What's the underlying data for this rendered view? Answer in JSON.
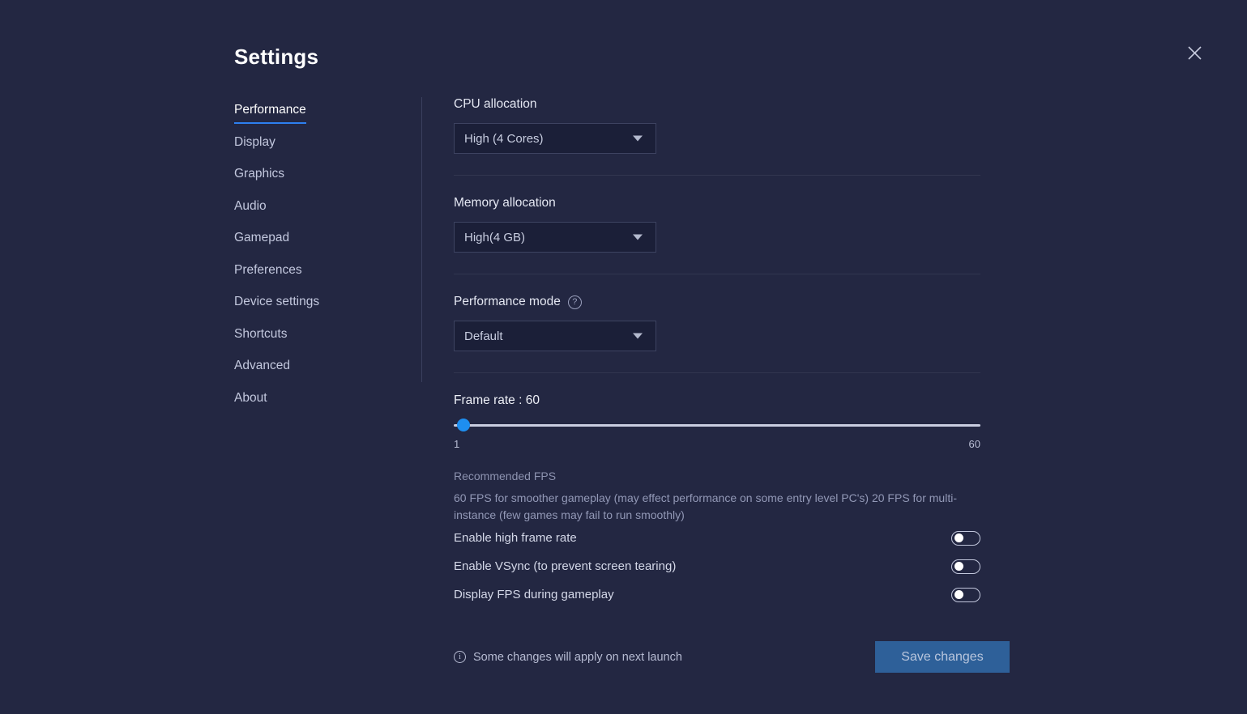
{
  "window": {
    "title": "Settings",
    "close_icon": "close-icon"
  },
  "sidebar": {
    "items": [
      {
        "label": "Performance",
        "active": true
      },
      {
        "label": "Display",
        "active": false
      },
      {
        "label": "Graphics",
        "active": false
      },
      {
        "label": "Audio",
        "active": false
      },
      {
        "label": "Gamepad",
        "active": false
      },
      {
        "label": "Preferences",
        "active": false
      },
      {
        "label": "Device settings",
        "active": false
      },
      {
        "label": "Shortcuts",
        "active": false
      },
      {
        "label": "Advanced",
        "active": false
      },
      {
        "label": "About",
        "active": false
      }
    ]
  },
  "main": {
    "cpu": {
      "label": "CPU allocation",
      "value": "High (4 Cores)"
    },
    "memory": {
      "label": "Memory allocation",
      "value": "High(4 GB)"
    },
    "performance_mode": {
      "label": "Performance mode",
      "help_icon": "question-mark-icon",
      "value": "Default"
    },
    "frame_rate": {
      "label": "Frame rate : 60",
      "value": 60,
      "min_label": "1",
      "max_label": "60",
      "thumb_percent": 0
    },
    "recommended": {
      "title": "Recommended FPS",
      "body": "60 FPS for smoother gameplay (may effect performance on some entry level PC's) 20 FPS for multi-instance (few games may fail to run smoothly)"
    },
    "toggles": [
      {
        "label": "Enable high frame rate",
        "on": false
      },
      {
        "label": "Enable VSync (to prevent screen tearing)",
        "on": false
      },
      {
        "label": "Display FPS during gameplay",
        "on": false
      }
    ]
  },
  "footer": {
    "info_icon": "info-icon",
    "note": "Some changes will apply on next launch",
    "save_label": "Save changes"
  },
  "colors": {
    "background": "#232742",
    "accent": "#2d7ff0",
    "slider_thumb": "#1e8ef0",
    "save_button": "#2e6099",
    "field_background": "#1b1f38"
  }
}
